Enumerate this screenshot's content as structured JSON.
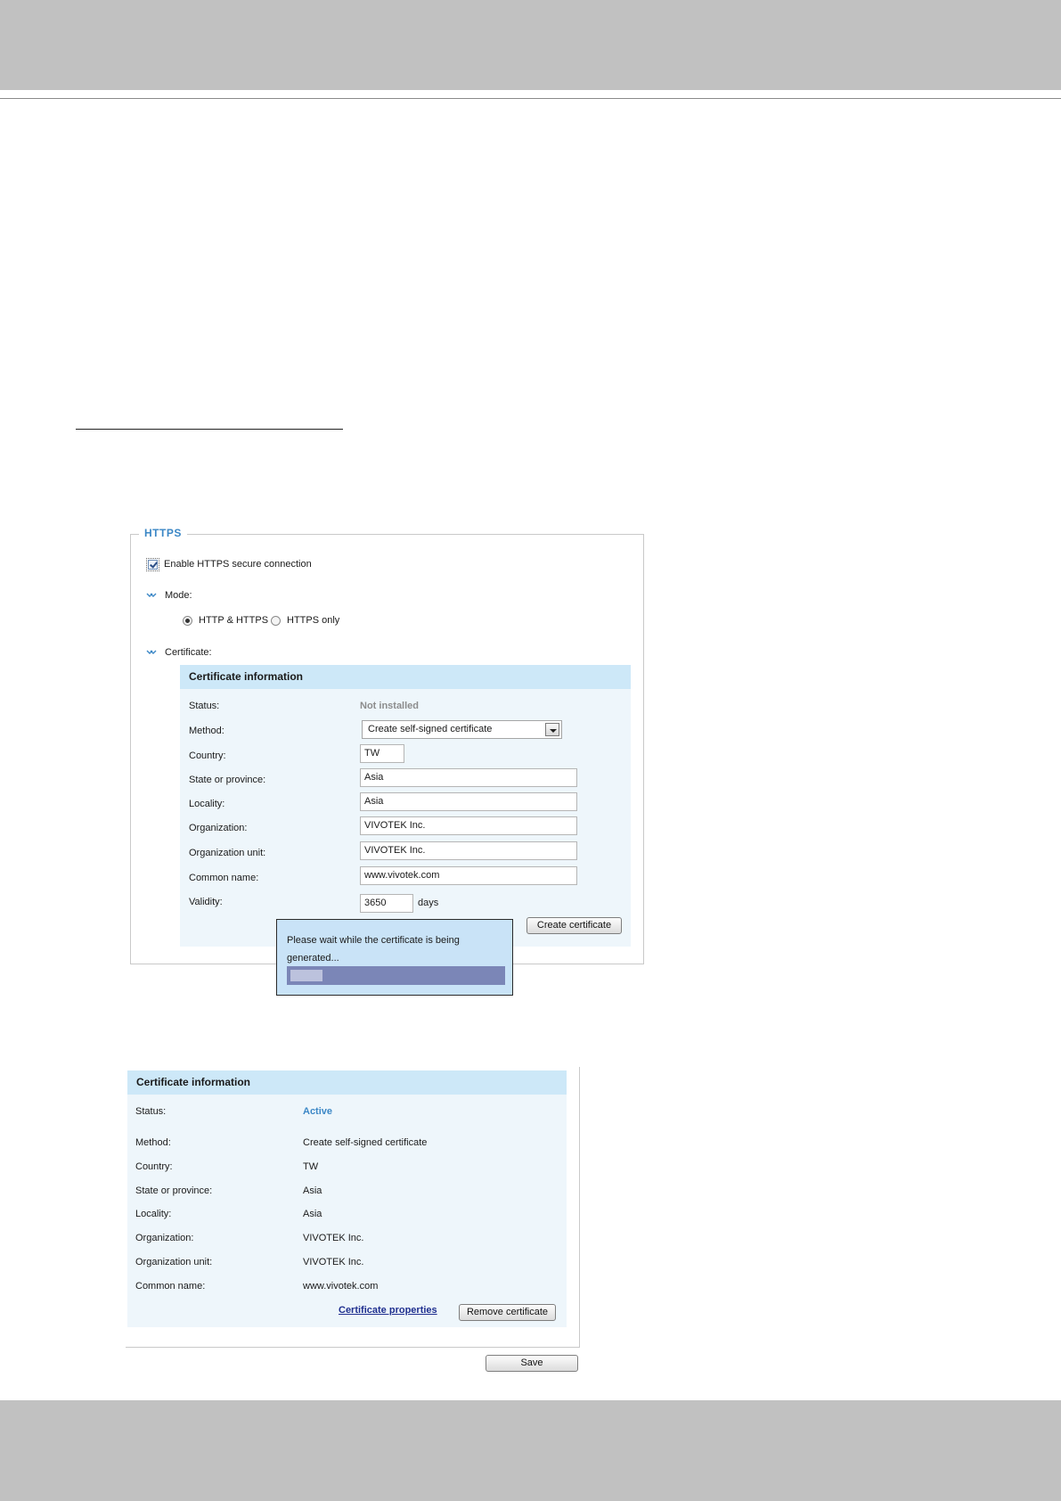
{
  "https": {
    "legend": "HTTPS",
    "enable_label": "Enable HTTPS secure connection",
    "enable_checked": true,
    "mode_label": "Mode:",
    "mode_options": [
      {
        "label": "HTTP & HTTPS",
        "selected": true
      },
      {
        "label": "HTTPS only",
        "selected": false
      }
    ],
    "certificate_label": "Certificate:"
  },
  "form": {
    "title": "Certificate information",
    "status_label": "Status:",
    "status_value": "Not installed",
    "method_label": "Method:",
    "method_value": "Create self-signed certificate",
    "country_label": "Country:",
    "country_value": "TW",
    "state_label": "State or province:",
    "state_value": "Asia",
    "locality_label": "Locality:",
    "locality_value": "Asia",
    "org_label": "Organization:",
    "org_value": "VIVOTEK Inc.",
    "org_unit_label": "Organization unit:",
    "org_unit_value": "VIVOTEK Inc.",
    "common_name_label": "Common name:",
    "common_name_value": "www.vivotek.com",
    "validity_label": "Validity:",
    "validity_value": "3650",
    "validity_unit": "days",
    "create_button": "Create certificate"
  },
  "popup": {
    "message": "Please wait while the certificate is being generated...",
    "progress": 0.15
  },
  "info": {
    "title": "Certificate information",
    "status_label": "Status:",
    "status_value": "Active",
    "method_label": "Method:",
    "method_value": "Create self-signed certificate",
    "country_label": "Country:",
    "country_value": "TW",
    "state_label": "State or province:",
    "state_value": "Asia",
    "locality_label": "Locality:",
    "locality_value": "Asia",
    "org_label": "Organization:",
    "org_value": "VIVOTEK Inc.",
    "org_unit_label": "Organization unit:",
    "org_unit_value": "VIVOTEK Inc.",
    "common_name_label": "Common name:",
    "common_name_value": "www.vivotek.com",
    "properties_link": "Certificate properties",
    "remove_button": "Remove certificate",
    "save_button": "Save"
  },
  "colors": {
    "accent_blue": "#3b87c6",
    "panel_header": "#cde8f8",
    "panel_body": "#eef6fb",
    "page_band": "#c1c1c1",
    "progress_bar": "#7b86b7"
  }
}
